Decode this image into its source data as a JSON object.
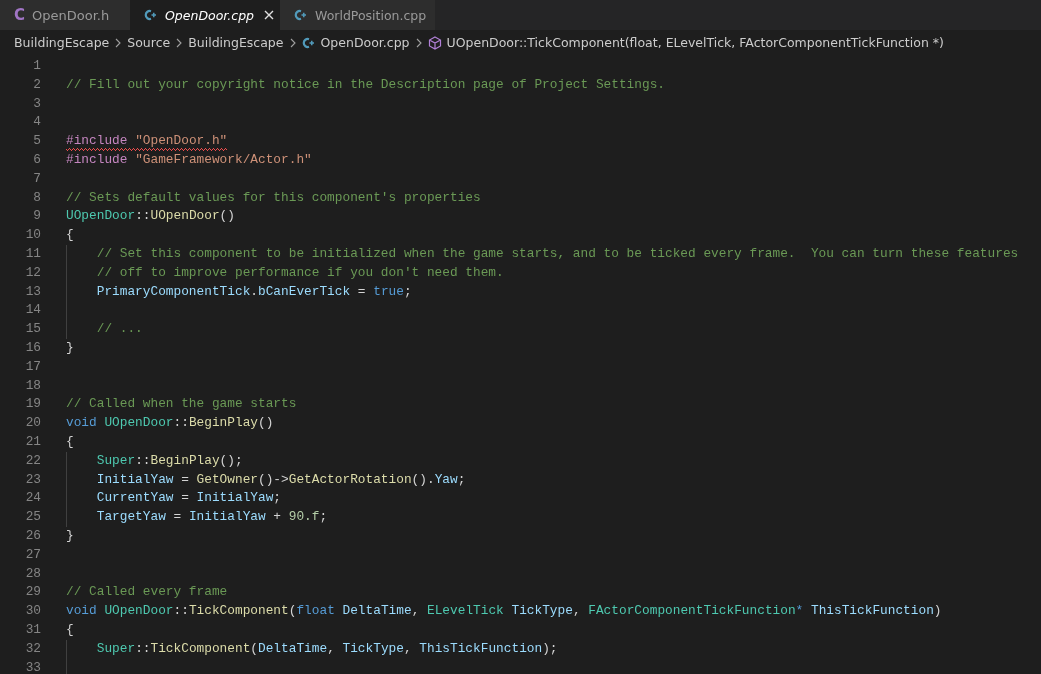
{
  "tabs": [
    {
      "label": "OpenDoor.h",
      "kind": "c",
      "icon_text": "C",
      "selected": false,
      "preview": false
    },
    {
      "label": "OpenDoor.cpp",
      "kind": "cpp",
      "selected": true,
      "preview": true
    },
    {
      "label": "WorldPosition.cpp",
      "kind": "cpp",
      "selected": false,
      "preview": false
    }
  ],
  "breadcrumb": [
    {
      "label": "BuildingEscape",
      "kind": "folder"
    },
    {
      "label": "Source",
      "kind": "folder"
    },
    {
      "label": "BuildingEscape",
      "kind": "folder"
    },
    {
      "label": "OpenDoor.cpp",
      "kind": "cpp"
    },
    {
      "label": "UOpenDoor::TickComponent(float, ELevelTick, FActorComponentTickFunction *)",
      "kind": "method"
    }
  ],
  "lines": [
    {
      "number": "1"
    },
    {
      "number": "2",
      "guide": false,
      "error": false,
      "tokens": [
        {
          "text": "// Fill out your copyright notice in the Description page of Project Settings.",
          "kind": "comment"
        }
      ]
    },
    {
      "number": "3"
    },
    {
      "number": "4"
    },
    {
      "number": "5",
      "guide": false,
      "error": true,
      "tokens": [
        {
          "text": "#include ",
          "kind": "preproc"
        },
        {
          "text": "\"OpenDoor.h\"",
          "kind": "string"
        }
      ]
    },
    {
      "number": "6",
      "guide": false,
      "error": false,
      "tokens": [
        {
          "text": "#include ",
          "kind": "preproc"
        },
        {
          "text": "\"GameFramework/Actor.h\"",
          "kind": "string"
        }
      ]
    },
    {
      "number": "7"
    },
    {
      "number": "8",
      "guide": false,
      "error": false,
      "tokens": [
        {
          "text": "// Sets default values for this component's properties",
          "kind": "comment"
        }
      ]
    },
    {
      "number": "9",
      "guide": false,
      "error": false,
      "tokens": [
        {
          "text": "UOpenDoor",
          "kind": "type"
        },
        {
          "text": "::",
          "kind": "plain"
        },
        {
          "text": "UOpenDoor",
          "kind": "func"
        },
        {
          "text": "()",
          "kind": "plain"
        }
      ]
    },
    {
      "number": "10",
      "guide": false,
      "error": false,
      "tokens": [
        {
          "text": "{",
          "kind": "plain"
        }
      ]
    },
    {
      "number": "11",
      "guide": true,
      "error": false,
      "tokens": [
        {
          "text": "    // Set this component to be initialized when the game starts, and to be ticked every frame.  You can turn these features",
          "kind": "comment"
        }
      ]
    },
    {
      "number": "12",
      "guide": true,
      "error": false,
      "tokens": [
        {
          "text": "    // off to improve performance if you don't need them.",
          "kind": "comment"
        }
      ]
    },
    {
      "number": "13",
      "guide": true,
      "error": false,
      "tokens": [
        {
          "text": "    PrimaryComponentTick",
          "kind": "var"
        },
        {
          "text": ".",
          "kind": "plain"
        },
        {
          "text": "bCanEverTick",
          "kind": "var"
        },
        {
          "text": " = ",
          "kind": "plain"
        },
        {
          "text": "true",
          "kind": "keyword"
        },
        {
          "text": ";",
          "kind": "plain"
        }
      ]
    },
    {
      "number": "14",
      "guide": true
    },
    {
      "number": "15",
      "guide": true,
      "error": false,
      "tokens": [
        {
          "text": "    // ...",
          "kind": "comment"
        }
      ]
    },
    {
      "number": "16",
      "guide": false,
      "error": false,
      "tokens": [
        {
          "text": "}",
          "kind": "plain"
        }
      ]
    },
    {
      "number": "17"
    },
    {
      "number": "18"
    },
    {
      "number": "19",
      "guide": false,
      "error": false,
      "tokens": [
        {
          "text": "// Called when the game starts",
          "kind": "comment"
        }
      ]
    },
    {
      "number": "20",
      "guide": false,
      "error": false,
      "tokens": [
        {
          "text": "void ",
          "kind": "keyword"
        },
        {
          "text": "UOpenDoor",
          "kind": "type"
        },
        {
          "text": "::",
          "kind": "plain"
        },
        {
          "text": "BeginPlay",
          "kind": "func"
        },
        {
          "text": "()",
          "kind": "plain"
        }
      ]
    },
    {
      "number": "21",
      "guide": false,
      "error": false,
      "tokens": [
        {
          "text": "{",
          "kind": "plain"
        }
      ]
    },
    {
      "number": "22",
      "guide": true,
      "error": false,
      "tokens": [
        {
          "text": "    Super",
          "kind": "type"
        },
        {
          "text": "::",
          "kind": "plain"
        },
        {
          "text": "BeginPlay",
          "kind": "func"
        },
        {
          "text": "();",
          "kind": "plain"
        }
      ]
    },
    {
      "number": "23",
      "guide": true,
      "error": false,
      "tokens": [
        {
          "text": "    InitialYaw",
          "kind": "var"
        },
        {
          "text": " = ",
          "kind": "plain"
        },
        {
          "text": "GetOwner",
          "kind": "func"
        },
        {
          "text": "()->",
          "kind": "plain"
        },
        {
          "text": "GetActorRotation",
          "kind": "func"
        },
        {
          "text": "().",
          "kind": "plain"
        },
        {
          "text": "Yaw",
          "kind": "var"
        },
        {
          "text": ";",
          "kind": "plain"
        }
      ]
    },
    {
      "number": "24",
      "guide": true,
      "error": false,
      "tokens": [
        {
          "text": "    CurrentYaw",
          "kind": "var"
        },
        {
          "text": " = ",
          "kind": "plain"
        },
        {
          "text": "InitialYaw",
          "kind": "var"
        },
        {
          "text": ";",
          "kind": "plain"
        }
      ]
    },
    {
      "number": "25",
      "guide": true,
      "error": false,
      "tokens": [
        {
          "text": "    TargetYaw",
          "kind": "var"
        },
        {
          "text": " = ",
          "kind": "plain"
        },
        {
          "text": "InitialYaw",
          "kind": "var"
        },
        {
          "text": " + ",
          "kind": "plain"
        },
        {
          "text": "90.f",
          "kind": "number"
        },
        {
          "text": ";",
          "kind": "plain"
        }
      ]
    },
    {
      "number": "26",
      "guide": false,
      "error": false,
      "tokens": [
        {
          "text": "}",
          "kind": "plain"
        }
      ]
    },
    {
      "number": "27"
    },
    {
      "number": "28"
    },
    {
      "number": "29",
      "guide": false,
      "error": false,
      "tokens": [
        {
          "text": "// Called every frame",
          "kind": "comment"
        }
      ]
    },
    {
      "number": "30",
      "guide": false,
      "error": false,
      "tokens": [
        {
          "text": "void ",
          "kind": "keyword"
        },
        {
          "text": "UOpenDoor",
          "kind": "type"
        },
        {
          "text": "::",
          "kind": "plain"
        },
        {
          "text": "TickComponent",
          "kind": "func"
        },
        {
          "text": "(",
          "kind": "plain"
        },
        {
          "text": "float ",
          "kind": "keyword"
        },
        {
          "text": "DeltaTime",
          "kind": "var"
        },
        {
          "text": ", ",
          "kind": "plain"
        },
        {
          "text": "ELevelTick ",
          "kind": "type"
        },
        {
          "text": "TickType",
          "kind": "var"
        },
        {
          "text": ", ",
          "kind": "plain"
        },
        {
          "text": "FActorComponentTickFunction",
          "kind": "type"
        },
        {
          "text": "* ",
          "kind": "keyword"
        },
        {
          "text": "ThisTickFunction",
          "kind": "var"
        },
        {
          "text": ")",
          "kind": "plain"
        }
      ]
    },
    {
      "number": "31",
      "guide": false,
      "error": false,
      "tokens": [
        {
          "text": "{",
          "kind": "plain"
        }
      ]
    },
    {
      "number": "32",
      "guide": true,
      "error": false,
      "tokens": [
        {
          "text": "    Super",
          "kind": "type"
        },
        {
          "text": "::",
          "kind": "plain"
        },
        {
          "text": "TickComponent",
          "kind": "func"
        },
        {
          "text": "(",
          "kind": "plain"
        },
        {
          "text": "DeltaTime",
          "kind": "var"
        },
        {
          "text": ", ",
          "kind": "plain"
        },
        {
          "text": "TickType",
          "kind": "var"
        },
        {
          "text": ", ",
          "kind": "plain"
        },
        {
          "text": "ThisTickFunction",
          "kind": "var"
        },
        {
          "text": ");",
          "kind": "plain"
        }
      ]
    },
    {
      "number": "33",
      "guide": true
    }
  ]
}
